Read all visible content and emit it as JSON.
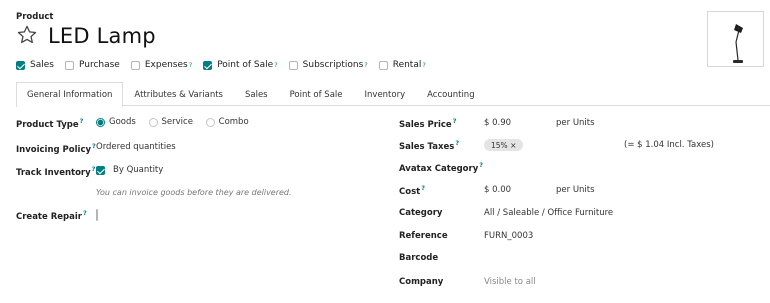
{
  "header": {
    "kicker": "Product",
    "title": "LED Lamp"
  },
  "checks": [
    {
      "label": "Sales",
      "checked": true,
      "hint": ""
    },
    {
      "label": "Purchase",
      "checked": false,
      "hint": ""
    },
    {
      "label": "Expenses",
      "checked": false,
      "hint": "?"
    },
    {
      "label": "Point of Sale",
      "checked": true,
      "hint": "?"
    },
    {
      "label": "Subscriptions",
      "checked": false,
      "hint": "?"
    },
    {
      "label": "Rental",
      "checked": false,
      "hint": "?"
    }
  ],
  "tabs": [
    {
      "label": "General Information",
      "active": true
    },
    {
      "label": "Attributes & Variants",
      "active": false
    },
    {
      "label": "Sales",
      "active": false
    },
    {
      "label": "Point of Sale",
      "active": false
    },
    {
      "label": "Inventory",
      "active": false
    },
    {
      "label": "Accounting",
      "active": false
    }
  ],
  "left": {
    "product_type": {
      "label": "Product Type",
      "hint": "?",
      "options": [
        "Goods",
        "Service",
        "Combo"
      ],
      "selected": "Goods"
    },
    "invoicing_policy": {
      "label": "Invoicing Policy",
      "hint": "?",
      "value": "Ordered quantities"
    },
    "track_inventory": {
      "label": "Track Inventory",
      "hint": "?",
      "checked": true,
      "option": "By Quantity"
    },
    "note": "You can invoice goods before they are delivered.",
    "create_repair": {
      "label": "Create Repair",
      "hint": "?",
      "checked": false
    }
  },
  "right": {
    "sales_price": {
      "label": "Sales Price",
      "hint": "?",
      "value": "$ 0.90",
      "unit": "per Units"
    },
    "sales_taxes": {
      "label": "Sales Taxes",
      "hint": "?",
      "tag": "15%",
      "tag_remove": "×",
      "incl": "(= $ 1.04 Incl. Taxes)"
    },
    "avatax": {
      "label": "Avatax Category",
      "hint": "?"
    },
    "cost": {
      "label": "Cost",
      "hint": "?",
      "value": "$ 0.00",
      "unit": "per Units"
    },
    "category": {
      "label": "Category",
      "value": "All / Saleable / Office Furniture"
    },
    "reference": {
      "label": "Reference",
      "value": "FURN_0003"
    },
    "barcode": {
      "label": "Barcode",
      "value": ""
    },
    "company": {
      "label": "Company",
      "placeholder": "Visible to all"
    }
  },
  "colors": {
    "accent": "#017e84",
    "tag_bg": "#e4e4e4",
    "border": "#dcdcdc"
  }
}
